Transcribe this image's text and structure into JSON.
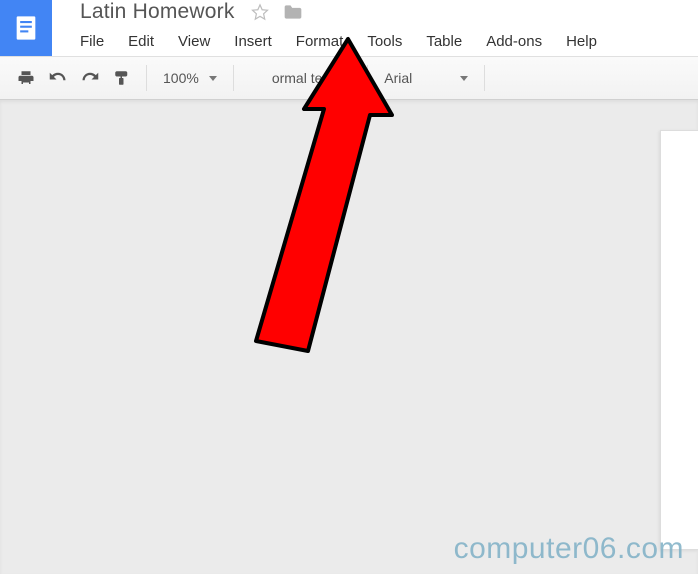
{
  "header": {
    "doc_title": "Latin Homework"
  },
  "menubar": {
    "items": [
      "File",
      "Edit",
      "View",
      "Insert",
      "Format",
      "Tools",
      "Table",
      "Add-ons",
      "Help"
    ]
  },
  "toolbar": {
    "zoom": "100%",
    "style": "ormal text",
    "font": "Arial"
  },
  "watermark": "computer06.com"
}
